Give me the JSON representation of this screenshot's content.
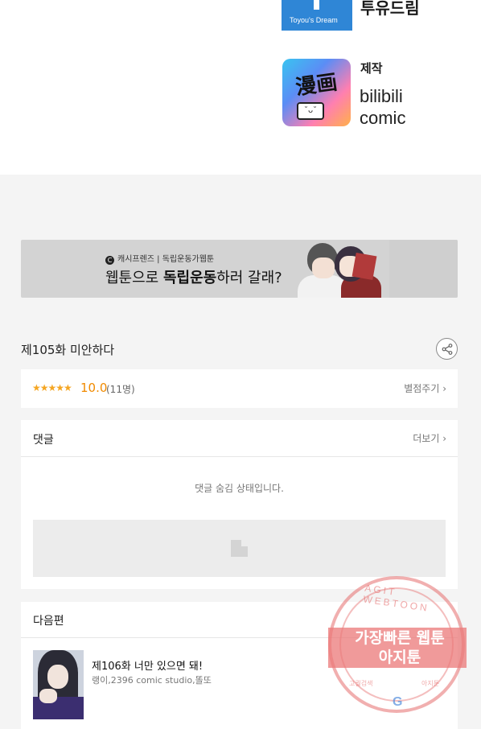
{
  "credits": {
    "toyou_logo_text": "Toyou's Dream",
    "toyou_name": "투유드림",
    "production_label": "제작",
    "bili_logo_text": "漫画",
    "bili_name_line1": "bilibili",
    "bili_name_line2": "comic"
  },
  "banner": {
    "subtitle": "캐시프렌즈 | 독립운동가웹툰",
    "title_pre": "웹툰으로 ",
    "title_bold": "독립운동",
    "title_post": "하러 갈래?"
  },
  "episode": {
    "title": "제105화 미안하다"
  },
  "rating": {
    "stars": "★★★★★",
    "score": "10.0",
    "count": "(11명)",
    "give_label": "별점주기 ›"
  },
  "comments": {
    "title": "댓글",
    "more_label": "더보기 ›",
    "hidden_message": "댓글 숨김 상태입니다."
  },
  "next": {
    "title": "다음편",
    "episode_title": "제106화 너만 있으면 돼!",
    "authors": "랭이,2396 comic studio,똘또"
  },
  "watermark": {
    "ring_text": "AGIT WEBTOON",
    "line1": "가장빠른 웹툰",
    "line2": "아지툰",
    "bottom_left": "고퀄검색",
    "bottom_right": "아지툰",
    "g": "G"
  },
  "colors": {
    "star": "#f5a623",
    "score": "#f08a00",
    "toyou_blue": "#2f86d6"
  }
}
